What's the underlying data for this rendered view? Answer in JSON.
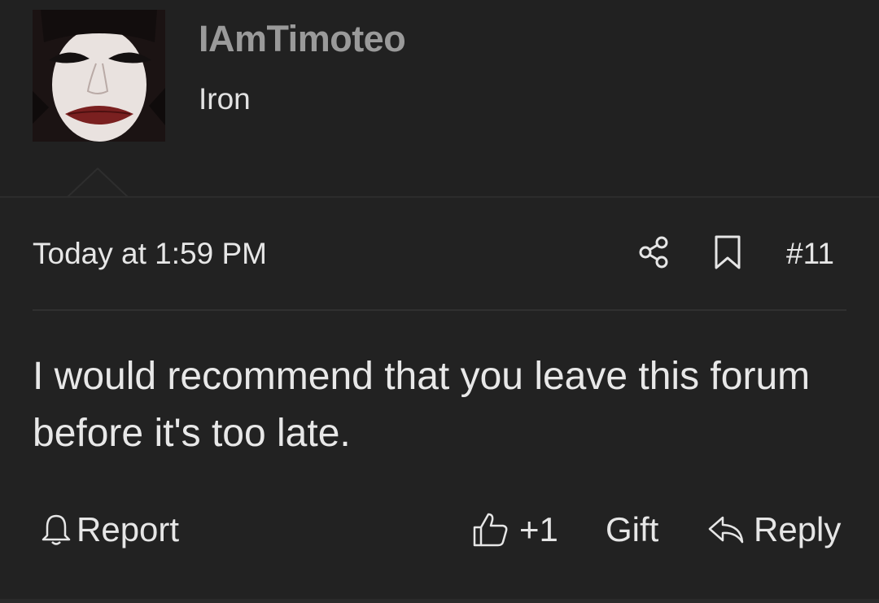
{
  "user": {
    "name": "IAmTimoteo",
    "title": "Iron",
    "avatar_icon": "profile-avatar-face"
  },
  "post": {
    "timestamp": "Today at 1:59 PM",
    "number": "#11",
    "message": "I would recommend that you leave this forum before it's too late."
  },
  "actions": {
    "report_label": "Report",
    "like_count": "+1",
    "gift_label": "Gift",
    "reply_label": "Reply"
  },
  "icons": {
    "share": "share-icon",
    "bookmark": "bookmark-icon",
    "report": "bell-icon",
    "like": "thumbs-up-icon",
    "reply": "reply-arrow-icon"
  },
  "colors": {
    "background": "#222222",
    "text": "#e6e6e6",
    "username": "#9a9a9a"
  }
}
